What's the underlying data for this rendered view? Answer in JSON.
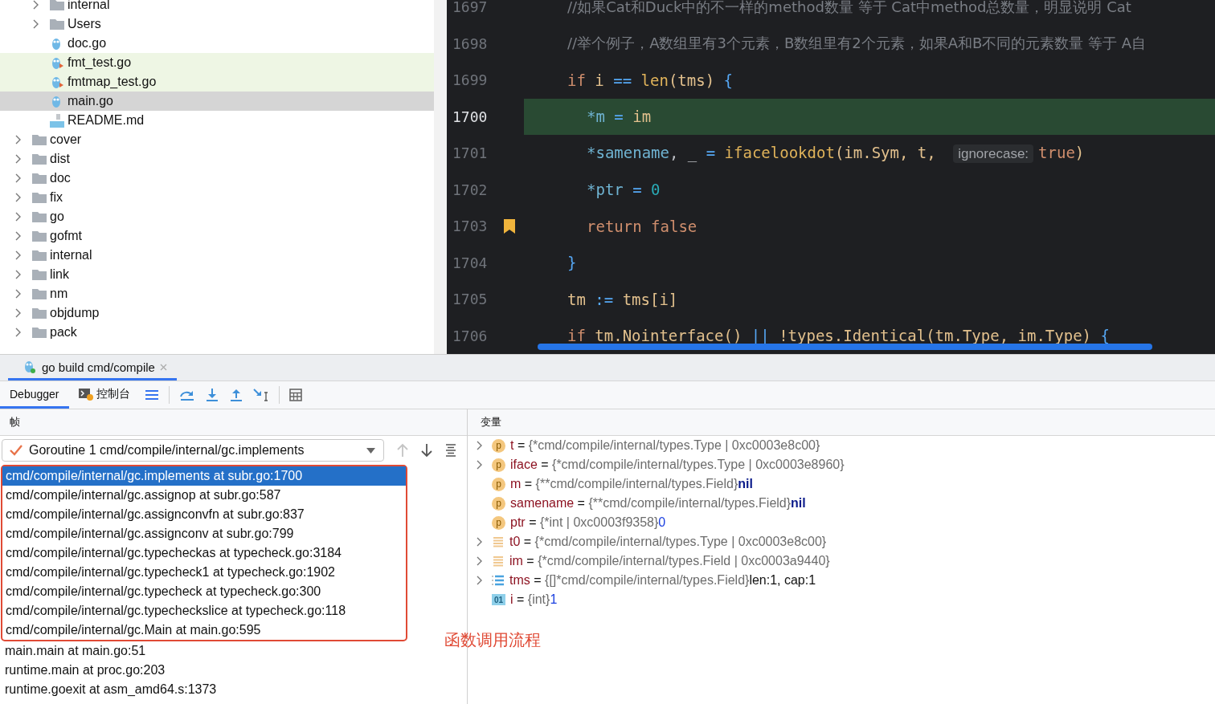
{
  "project_tree": [
    {
      "children": [
        {
          "label": "internal",
          "kind": "folder",
          "expanded": false,
          "selected": false,
          "highlighted": false
        },
        {
          "label": "Users",
          "kind": "folder",
          "expanded": false,
          "selected": false,
          "highlighted": false
        },
        {
          "label": "doc.go",
          "kind": "go",
          "selected": false,
          "highlighted": false
        },
        {
          "label": "fmt_test.go",
          "kind": "go_test",
          "selected": false,
          "highlighted": true
        },
        {
          "label": "fmtmap_test.go",
          "kind": "go_test",
          "selected": false,
          "highlighted": true
        },
        {
          "label": "main.go",
          "kind": "go",
          "selected": true,
          "highlighted": false
        },
        {
          "label": "README.md",
          "kind": "md",
          "selected": false,
          "highlighted": false
        }
      ]
    },
    {
      "label": "cover",
      "kind": "folder",
      "expanded": false,
      "selected": false,
      "highlighted": false
    },
    {
      "label": "dist",
      "kind": "folder",
      "expanded": false,
      "selected": false,
      "highlighted": false
    },
    {
      "label": "doc",
      "kind": "folder",
      "expanded": false,
      "selected": false,
      "highlighted": false
    },
    {
      "label": "fix",
      "kind": "folder",
      "expanded": false,
      "selected": false,
      "highlighted": false
    },
    {
      "label": "go",
      "kind": "folder",
      "expanded": false,
      "selected": false,
      "highlighted": false
    },
    {
      "label": "gofmt",
      "kind": "folder",
      "expanded": false,
      "selected": false,
      "highlighted": false
    },
    {
      "label": "internal",
      "kind": "folder",
      "expanded": false,
      "selected": false,
      "highlighted": false
    },
    {
      "label": "link",
      "kind": "folder",
      "expanded": false,
      "selected": false,
      "highlighted": false
    },
    {
      "label": "nm",
      "kind": "folder",
      "expanded": false,
      "selected": false,
      "highlighted": false
    },
    {
      "label": "objdump",
      "kind": "folder",
      "expanded": false,
      "selected": false,
      "highlighted": false
    },
    {
      "label": "pack",
      "kind": "folder",
      "expanded": false,
      "selected": false,
      "highlighted": false
    }
  ],
  "editor": {
    "lines": [
      {
        "number": "1697",
        "current": false,
        "bookmark": false,
        "tokens": [
          {
            "t": "//如果Cat和Duck中的不一样的method数量 等于 Cat中method总数量，明显说明 Cat",
            "kind": "comment"
          }
        ]
      },
      {
        "number": "1698",
        "current": false,
        "bookmark": false,
        "tokens": [
          {
            "t": "//举个例子，A数组里有3个元素，B数组里有2个元素，如果A和B不同的元素数量 等于 A自",
            "kind": "comment"
          }
        ]
      },
      {
        "number": "1699",
        "current": false,
        "bookmark": false,
        "tokens": [
          {
            "t": "if",
            "kind": "kw"
          },
          {
            "t": " i ",
            "kind": "var"
          },
          {
            "t": "==",
            "kind": "op"
          },
          {
            "t": " len",
            "kind": "fn"
          },
          {
            "t": "(",
            "kind": "paren"
          },
          {
            "t": "tms",
            "kind": "var"
          },
          {
            "t": ")",
            "kind": "paren"
          },
          {
            "t": " {",
            "kind": "op"
          }
        ],
        "children": [
          {
            "number": "1700",
            "current": true,
            "bookmark": false,
            "tokens": [
              {
                "t": "*m",
                "kind": "ptr"
              },
              {
                "t": " = ",
                "kind": "op"
              },
              {
                "t": "im",
                "kind": "var"
              }
            ]
          },
          {
            "number": "1701",
            "current": false,
            "bookmark": false,
            "tokens": [
              {
                "t": "*samename",
                "kind": "ptr"
              },
              {
                "t": ", _ ",
                "kind": "plain"
              },
              {
                "t": "= ",
                "kind": "op"
              },
              {
                "t": "ifacelookdot",
                "kind": "fn"
              },
              {
                "t": "(",
                "kind": "paren"
              },
              {
                "t": "im.Sym, t, ",
                "kind": "var"
              },
              {
                "t": "ignorecase:",
                "kind": "hint"
              },
              {
                "t": "true",
                "kind": "kw"
              },
              {
                "t": ")",
                "kind": "paren"
              }
            ]
          },
          {
            "number": "1702",
            "current": false,
            "bookmark": false,
            "tokens": [
              {
                "t": "*ptr",
                "kind": "ptr"
              },
              {
                "t": " = ",
                "kind": "op"
              },
              {
                "t": "0",
                "kind": "num"
              }
            ]
          },
          {
            "number": "1703",
            "current": false,
            "bookmark": true,
            "tokens": [
              {
                "t": "return false",
                "kind": "kw"
              }
            ]
          }
        ]
      },
      {
        "number": "1704",
        "current": false,
        "bookmark": false,
        "tokens": [
          {
            "t": "}",
            "kind": "op"
          }
        ]
      },
      {
        "number": "1705",
        "current": false,
        "bookmark": false,
        "tokens": [
          {
            "t": "tm ",
            "kind": "var"
          },
          {
            "t": ":= ",
            "kind": "op"
          },
          {
            "t": "tms[i]",
            "kind": "var"
          }
        ]
      },
      {
        "number": "1706",
        "current": false,
        "bookmark": false,
        "tokens": [
          {
            "t": "if",
            "kind": "kw"
          },
          {
            "t": " tm.Nointerface() ",
            "kind": "var"
          },
          {
            "t": "||",
            "kind": "op"
          },
          {
            "t": " !types.Identical(tm.Type, im.Type) ",
            "kind": "var"
          },
          {
            "t": "{",
            "kind": "op"
          }
        ]
      }
    ]
  },
  "run_tabs": [
    {
      "label": "go build cmd/compile",
      "selected": true
    }
  ],
  "debugger_tabs": [
    {
      "label": "Debugger",
      "kind": "text",
      "selected": true
    },
    {
      "label": "控制台",
      "kind": "console",
      "selected": false
    }
  ],
  "toolbar": [
    {
      "kind": "lines"
    },
    {
      "kind": "step_over"
    },
    {
      "kind": "step_into"
    },
    {
      "kind": "step_out"
    },
    {
      "kind": "run_to_cursor"
    },
    {
      "kind": "calculator"
    }
  ],
  "frames": {
    "title": "帧",
    "goroutine": "Goroutine 1 cmd/compile/internal/gc.implements",
    "rows": [
      {
        "text": "cmd/compile/internal/gc.implements at subr.go:1700",
        "selected": true,
        "boxed": true
      },
      {
        "text": "cmd/compile/internal/gc.assignop at subr.go:587",
        "selected": false,
        "boxed": true
      },
      {
        "text": "cmd/compile/internal/gc.assignconvfn at subr.go:837",
        "selected": false,
        "boxed": true
      },
      {
        "text": "cmd/compile/internal/gc.assignconv at subr.go:799",
        "selected": false,
        "boxed": true
      },
      {
        "text": "cmd/compile/internal/gc.typecheckas at typecheck.go:3184",
        "selected": false,
        "boxed": true
      },
      {
        "text": "cmd/compile/internal/gc.typecheck1 at typecheck.go:1902",
        "selected": false,
        "boxed": true
      },
      {
        "text": "cmd/compile/internal/gc.typecheck at typecheck.go:300",
        "selected": false,
        "boxed": true
      },
      {
        "text": "cmd/compile/internal/gc.typecheckslice at typecheck.go:118",
        "selected": false,
        "boxed": true
      },
      {
        "text": "cmd/compile/internal/gc.Main at main.go:595",
        "selected": false,
        "boxed": true
      },
      {
        "text": "main.main at main.go:51",
        "selected": false,
        "boxed": false
      },
      {
        "text": "runtime.main at proc.go:203",
        "selected": false,
        "boxed": false
      },
      {
        "text": "runtime.goexit at asm_amd64.s:1373",
        "selected": false,
        "boxed": false
      }
    ],
    "annotation": "函数调用流程"
  },
  "variables": {
    "title": "变量",
    "items": [
      {
        "name": "t",
        "eq": "=",
        "type": "{*cmd/compile/internal/types.Type | 0xc0003e8c00}",
        "kind": "param",
        "badge": "p",
        "expandable": true
      },
      {
        "name": "iface",
        "eq": "=",
        "type": "{*cmd/compile/internal/types.Type | 0xc0003e8960}",
        "kind": "param",
        "badge": "p",
        "expandable": true
      },
      {
        "name": "m",
        "eq": "=",
        "type": "{**cmd/compile/internal/types.Field}",
        "value": {
          "text": "nil",
          "kind": "null"
        },
        "kind": "param",
        "badge": "p",
        "expandable": false
      },
      {
        "name": "samename",
        "eq": "=",
        "type": "{**cmd/compile/internal/types.Field}",
        "value": {
          "text": "nil",
          "kind": "null"
        },
        "kind": "param",
        "badge": "p",
        "expandable": false
      },
      {
        "name": "ptr",
        "eq": "=",
        "type": "{*int | 0xc0003f9358}",
        "value": {
          "text": "0",
          "kind": "number"
        },
        "kind": "param",
        "badge": "p",
        "expandable": false
      },
      {
        "name": "t0",
        "eq": "=",
        "type": "{*cmd/compile/internal/types.Type | 0xc0003e8c00}",
        "kind": "field",
        "expandable": true
      },
      {
        "name": "im",
        "eq": "=",
        "type": "{*cmd/compile/internal/types.Field | 0xc0003a9440}",
        "kind": "field",
        "expandable": true
      },
      {
        "name": "tms",
        "eq": "=",
        "type": "{[]*cmd/compile/internal/types.Field}",
        "value": {
          "text": "len:1, cap:1",
          "kind": "plain"
        },
        "kind": "slice",
        "expandable": true
      },
      {
        "name": "i",
        "eq": "=",
        "type": "{int}",
        "value": {
          "text": "1",
          "kind": "number"
        },
        "kind": "int",
        "badge": "01",
        "expandable": false
      }
    ]
  }
}
